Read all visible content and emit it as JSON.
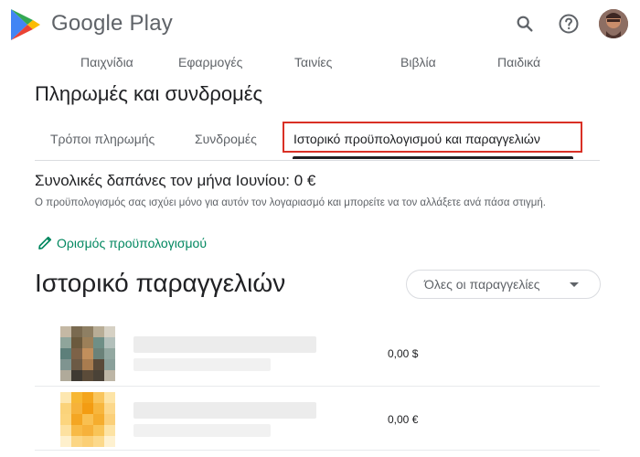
{
  "header": {
    "brand": "Google Play",
    "colors": {
      "play_green": "#00a173",
      "play_blue": "#4285f4",
      "play_red": "#ea4335",
      "play_yellow": "#fbbc04"
    }
  },
  "nav": {
    "items": [
      "Παιχνίδια",
      "Εφαρμογές",
      "Ταινίες",
      "Βιβλία",
      "Παιδικά"
    ]
  },
  "page_title": "Πληρωμές και συνδρομές",
  "tabs": [
    {
      "label": "Τρόποι πληρωμής",
      "active": false
    },
    {
      "label": "Συνδρομές",
      "active": false
    },
    {
      "label": "Ιστορικό προϋπολογισμού και παραγγελιών",
      "active": true
    }
  ],
  "budget": {
    "spending": "Συνολικές δαπάνες τον μήνα Ιουνίου: 0 €",
    "note": "Ο προϋπολογισμός σας ισχύει μόνο για αυτόν τον λογαριασμό και μπορείτε να τον αλλάξετε ανά πάσα στιγμή.",
    "set_link": "Ορισμός προϋπολογισμού",
    "accent_color": "#01875f",
    "highlight_color": "#d93025"
  },
  "orders": {
    "title": "Ιστορικό παραγγελιών",
    "filter": "Όλες οι παραγγελίες",
    "rows": [
      {
        "price": "0,00 $"
      },
      {
        "price": "0,00 €"
      }
    ]
  }
}
